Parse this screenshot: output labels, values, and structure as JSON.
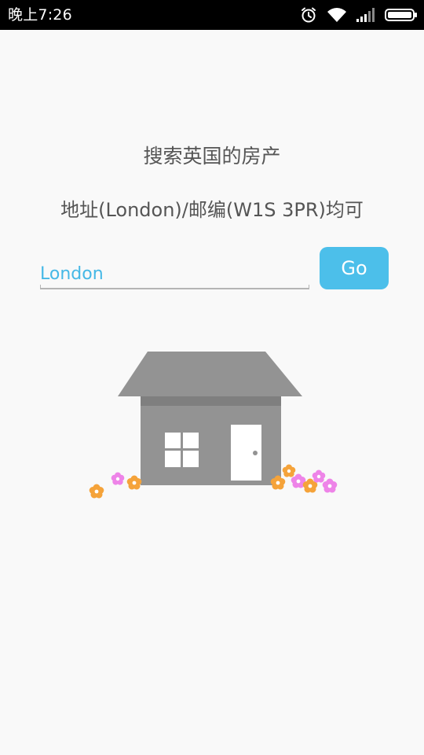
{
  "status_bar": {
    "time": "晚上7:26",
    "icons": [
      "alarm-icon",
      "wifi-icon",
      "signal-icon",
      "battery-icon"
    ]
  },
  "main": {
    "title": "搜索英国的房产",
    "subtitle": "地址(London)/邮编(W1S 3PR)均可"
  },
  "search": {
    "value": "London",
    "button_label": "Go"
  },
  "colors": {
    "accent": "#4cbfea",
    "input_text": "#45b8e6",
    "house": "#939393",
    "text": "#555555",
    "flower_orange": "#f5a33a",
    "flower_pink": "#ee84e8"
  }
}
